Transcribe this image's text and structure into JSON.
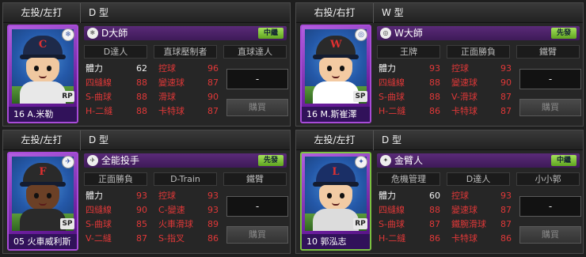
{
  "stat_labels_left": [
    "體力",
    "四縫線",
    "S-曲球",
    "H-二縫",
    "V-二縫"
  ],
  "panels": [
    {
      "hand": "左投/左打",
      "type": "D 型",
      "player": "16 A.米勒",
      "pos": "RP",
      "corner_icon": "snowflake",
      "skill_name": "D大師",
      "role": "中繼",
      "role_color": "#5fa420",
      "abilities": [
        "D達人",
        "直球壓制者",
        "直球達人"
      ],
      "stats": [
        {
          "label": "體力",
          "value": "62",
          "white": true
        },
        {
          "label": "四縫線",
          "value": "88"
        },
        {
          "label": "S-曲球",
          "value": "88"
        },
        {
          "label": "H-二縫",
          "value": "88"
        }
      ],
      "stats2": [
        {
          "label": "控球",
          "value": "96"
        },
        {
          "label": "變速球",
          "value": "87"
        },
        {
          "label": "滑球",
          "value": "90"
        },
        {
          "label": "卡特球",
          "value": "87"
        }
      ],
      "field": "-",
      "buy": "購買"
    },
    {
      "hand": "右投/右打",
      "type": "W 型",
      "player": "16 M.斯崔澤",
      "pos": "SP",
      "corner_icon": "swirl",
      "skill_name": "W大師",
      "role": "先發",
      "abilities": [
        "王牌",
        "正面勝負",
        "鐵臂"
      ],
      "stats": [
        {
          "label": "體力",
          "value": "93"
        },
        {
          "label": "四縫線",
          "value": "88"
        },
        {
          "label": "S-曲球",
          "value": "88"
        },
        {
          "label": "H-二縫",
          "value": "86"
        }
      ],
      "stats2": [
        {
          "label": "控球",
          "value": "93"
        },
        {
          "label": "變速球",
          "value": "90"
        },
        {
          "label": "V-滑球",
          "value": "87"
        },
        {
          "label": "卡特球",
          "value": "87"
        }
      ],
      "field": "-",
      "buy": "購買"
    },
    {
      "hand": "左投/左打",
      "type": "D 型",
      "player": "05 火車威利斯",
      "pos": "SP",
      "corner_icon": "wing",
      "skill_name": "全能投手",
      "role": "先發",
      "abilities": [
        "正面勝負",
        "D-Train",
        "鐵臂"
      ],
      "stats": [
        {
          "label": "體力",
          "value": "93"
        },
        {
          "label": "四縫線",
          "value": "90"
        },
        {
          "label": "S-曲球",
          "value": "85"
        },
        {
          "label": "V-二縫",
          "value": "87"
        }
      ],
      "stats2": [
        {
          "label": "控球",
          "value": "93"
        },
        {
          "label": "C-變速",
          "value": "93"
        },
        {
          "label": "火車滑球",
          "value": "89"
        },
        {
          "label": "S-指叉",
          "value": "86"
        }
      ],
      "field": "-",
      "buy": "購買"
    },
    {
      "hand": "左投/左打",
      "type": "D 型",
      "player": "10 郭泓志",
      "pos": "RP",
      "corner_icon": "star",
      "skill_name": "金臂人",
      "role": "中繼",
      "abilities": [
        "危機管理",
        "D達人",
        "小小郭"
      ],
      "stats": [
        {
          "label": "體力",
          "value": "60",
          "white": true
        },
        {
          "label": "四縫線",
          "value": "88"
        },
        {
          "label": "S-曲球",
          "value": "87"
        },
        {
          "label": "H-二縫",
          "value": "86"
        }
      ],
      "stats2": [
        {
          "label": "控球",
          "value": "93"
        },
        {
          "label": "變速球",
          "value": "87"
        },
        {
          "label": "鐵腕滑球",
          "value": "87"
        },
        {
          "label": "卡特球",
          "value": "86"
        }
      ],
      "field": "-",
      "buy": "購買"
    }
  ]
}
